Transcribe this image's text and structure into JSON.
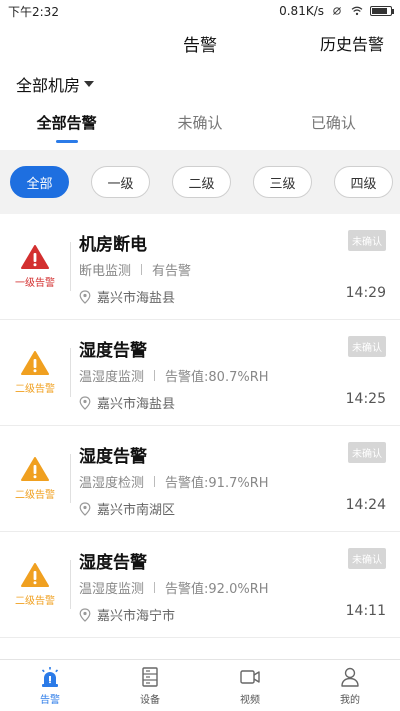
{
  "status_bar": {
    "time": "下午2:32",
    "speed": "0.81K/s",
    "icons": [
      "sync-off-icon",
      "wifi-icon",
      "battery-icon"
    ]
  },
  "header": {
    "title": "告警",
    "history_label": "历史告警"
  },
  "room_select": {
    "label": "全部机房"
  },
  "tabs": [
    {
      "label": "全部告警",
      "active": true
    },
    {
      "label": "未确认",
      "active": false
    },
    {
      "label": "已确认",
      "active": false
    }
  ],
  "filters": [
    {
      "label": "全部",
      "active": true
    },
    {
      "label": "一级",
      "active": false
    },
    {
      "label": "二级",
      "active": false
    },
    {
      "label": "三级",
      "active": false
    },
    {
      "label": "四级",
      "active": false
    }
  ],
  "alarms": [
    {
      "level_label": "一级告警",
      "level_color": "#d32f2f",
      "title": "机房断电",
      "type": "断电监测",
      "detail": "有告警",
      "location": "嘉兴市海盐县",
      "time": "14:29",
      "status": "未确认"
    },
    {
      "level_label": "二级告警",
      "level_color": "#f0a020",
      "title": "湿度告警",
      "type": "温湿度监测",
      "detail": "告警值:80.7%RH",
      "location": "嘉兴市海盐县",
      "time": "14:25",
      "status": "未确认"
    },
    {
      "level_label": "二级告警",
      "level_color": "#f0a020",
      "title": "湿度告警",
      "type": "温湿度检测",
      "detail": "告警值:91.7%RH",
      "location": "嘉兴市南湖区",
      "time": "14:24",
      "status": "未确认"
    },
    {
      "level_label": "二级告警",
      "level_color": "#f0a020",
      "title": "湿度告警",
      "type": "温湿度监测",
      "detail": "告警值:92.0%RH",
      "location": "嘉兴市海宁市",
      "time": "14:11",
      "status": "未确认"
    }
  ],
  "bottom_nav": [
    {
      "label": "告警",
      "icon": "alarm-icon",
      "active": true
    },
    {
      "label": "设备",
      "icon": "device-icon",
      "active": false
    },
    {
      "label": "视频",
      "icon": "video-icon",
      "active": false
    },
    {
      "label": "我的",
      "icon": "user-icon",
      "active": false
    }
  ],
  "colors": {
    "accent": "#1e6fe0",
    "level1": "#d32f2f",
    "level2": "#f0a020"
  }
}
